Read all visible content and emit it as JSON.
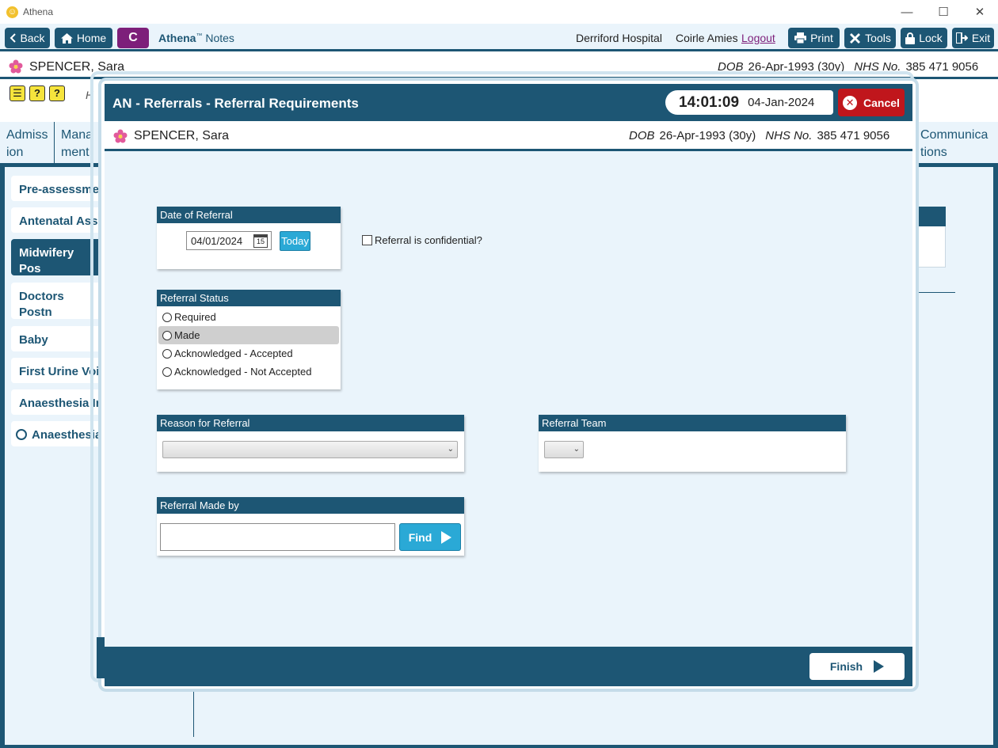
{
  "window": {
    "title": "Athena"
  },
  "toolbar": {
    "back": "Back",
    "home": "Home",
    "c_label": "C",
    "brand_name": "Athena",
    "brand_tm": "™",
    "brand_suffix": "Notes",
    "hospital": "Derriford Hospital",
    "user": "Coirle Amies",
    "logout": "Logout",
    "print": "Print",
    "tools": "Tools",
    "lock": "Lock",
    "exit": "Exit"
  },
  "patient": {
    "name": "SPENCER, Sara",
    "dob_label": "DOB",
    "dob": "26-Apr-1993 (30y)",
    "nhs_label": "NHS No.",
    "nhs": "385 471 9056"
  },
  "icons_row": [
    "?",
    "?"
  ],
  "header_partial": "H",
  "tabs": [
    {
      "label": "Admiss ion"
    },
    {
      "label": "Mana ment"
    },
    {
      "label": "Communica tions"
    }
  ],
  "nav": [
    {
      "label": "Pre-assessmer"
    },
    {
      "label": "Antenatal Ass"
    },
    {
      "label": "Midwifery Pos Assessments"
    },
    {
      "label": "Doctors Postn Assessments"
    },
    {
      "label": "Baby"
    },
    {
      "label": "First Urine Voi"
    },
    {
      "label": "Anaesthesia Ir"
    },
    {
      "label": "Anaesthesia"
    }
  ],
  "dialog": {
    "title": "AN - Referrals - Referral Requirements",
    "time": "14:01:09",
    "date": "04-Jan-2024",
    "cancel": "Cancel",
    "date_of_referral": {
      "heading": "Date of Referral",
      "value": "04/01/2024",
      "cal_day": "15",
      "today": "Today"
    },
    "confidential_label": "Referral is confidential?",
    "referral_status": {
      "heading": "Referral Status",
      "options": [
        "Required",
        "Made",
        "Acknowledged - Accepted",
        "Acknowledged - Not Accepted"
      ],
      "highlighted": "Made"
    },
    "reason": {
      "heading": "Reason for Referral",
      "value": ""
    },
    "team": {
      "heading": "Referral Team",
      "value": ""
    },
    "made_by": {
      "heading": "Referral Made by",
      "value": "",
      "find": "Find"
    },
    "finish": "Finish"
  },
  "colors": {
    "primary": "#1d5674",
    "accent": "#2aa9d6",
    "cancel": "#c0161c",
    "purple": "#7d1f7a",
    "background": "#eaf4fb"
  }
}
